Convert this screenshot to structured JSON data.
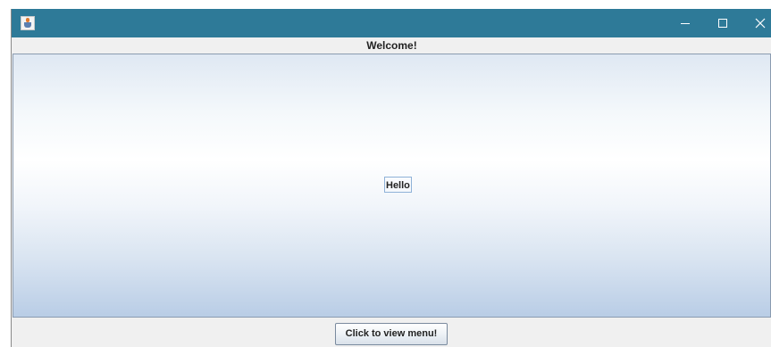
{
  "window": {
    "title": "",
    "app_icon": "java-cup-icon",
    "controls": {
      "minimize_icon": "minimize-icon",
      "maximize_icon": "maximize-icon",
      "close_icon": "close-icon"
    }
  },
  "header": {
    "welcome_text": "Welcome!"
  },
  "main": {
    "label_text": "Hello"
  },
  "footer": {
    "menu_button_label": "Click to view menu!"
  },
  "colors": {
    "titlebar": "#2e7a98",
    "panel_background": "#f0f0f0",
    "gradient_top": "#dfe8f3",
    "gradient_middle": "#ffffff",
    "gradient_bottom": "#b9cde6"
  }
}
